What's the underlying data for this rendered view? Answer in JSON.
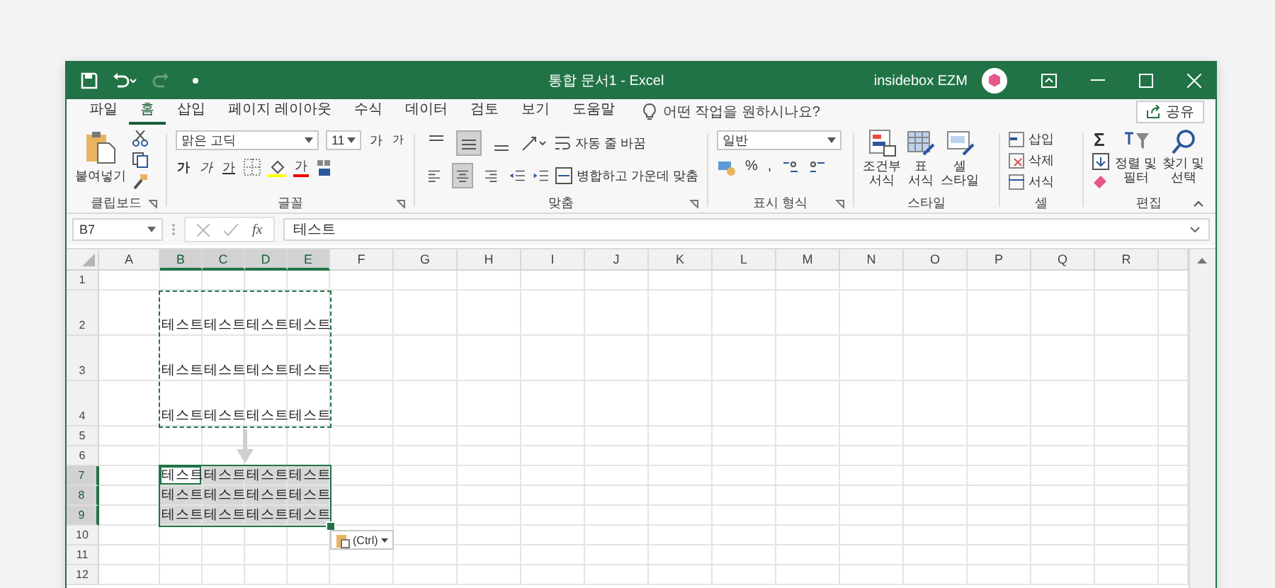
{
  "window": {
    "title": "통합 문서1 - Excel",
    "account": "insidebox EZM"
  },
  "menu_tabs": [
    {
      "label": "파일",
      "selected": false
    },
    {
      "label": "홈",
      "selected": true
    },
    {
      "label": "삽입",
      "selected": false
    },
    {
      "label": "페이지 레이아웃",
      "selected": false
    },
    {
      "label": "수식",
      "selected": false
    },
    {
      "label": "데이터",
      "selected": false
    },
    {
      "label": "검토",
      "selected": false
    },
    {
      "label": "보기",
      "selected": false
    },
    {
      "label": "도움말",
      "selected": false
    }
  ],
  "tell_me": {
    "placeholder": "어떤 작업을 원하시나요?"
  },
  "share_button": "공유",
  "ribbon": {
    "clipboard": {
      "label": "클립보드",
      "paste": "붙여넣기"
    },
    "font": {
      "label": "글꼴",
      "font_name": "맑은 고딕",
      "font_size": "11",
      "grow": "가",
      "shrink": "가",
      "bold": "가",
      "italic": "가",
      "underline": "가",
      "font_color": "가"
    },
    "alignment": {
      "label": "맞춤",
      "wrap_text": "자동 줄 바꿈",
      "merge_center": "병합하고 가운데 맞춤",
      "vertical_buttons": [
        {
          "selected": false
        },
        {
          "selected": true
        },
        {
          "selected": false
        }
      ],
      "horizontal_buttons": [
        {
          "selected": false
        },
        {
          "selected": true
        },
        {
          "selected": false
        }
      ]
    },
    "number": {
      "label": "표시 형식",
      "format": "일반",
      "percent": "%",
      "comma": ","
    },
    "styles": {
      "label": "스타일",
      "conditional": [
        "조건부",
        "서식"
      ],
      "table": [
        "표",
        "서식"
      ],
      "cell": [
        "셀",
        "스타일"
      ]
    },
    "cells": {
      "label": "셀",
      "insert": "삽입",
      "delete": "삭제",
      "format": "서식"
    },
    "editing": {
      "label": "편집",
      "sum": "Σ",
      "sort": [
        "정렬 및",
        "필터"
      ],
      "find": [
        "찾기 및",
        "선택"
      ]
    }
  },
  "formula_bar": {
    "name_box": "B7",
    "fx": "fx",
    "value": "테스트"
  },
  "sheet": {
    "columns": [
      {
        "label": "A",
        "selected": false
      },
      {
        "label": "B",
        "selected": true
      },
      {
        "label": "C",
        "selected": true
      },
      {
        "label": "D",
        "selected": true
      },
      {
        "label": "E",
        "selected": true
      },
      {
        "label": "F",
        "selected": false
      },
      {
        "label": "G",
        "selected": false
      },
      {
        "label": "H",
        "selected": false
      },
      {
        "label": "I",
        "selected": false
      },
      {
        "label": "J",
        "selected": false
      },
      {
        "label": "K",
        "selected": false
      },
      {
        "label": "L",
        "selected": false
      },
      {
        "label": "M",
        "selected": false
      },
      {
        "label": "N",
        "selected": false
      },
      {
        "label": "O",
        "selected": false
      },
      {
        "label": "P",
        "selected": false
      },
      {
        "label": "Q",
        "selected": false
      },
      {
        "label": "R",
        "selected": false
      }
    ],
    "rows": [
      {
        "header": "1",
        "tall": false,
        "selected": false
      },
      {
        "header": "2",
        "tall": true,
        "selected": false,
        "cells": [
          {
            "text": "테스트",
            "copied": true,
            "selected": false,
            "active": false
          },
          {
            "text": "테스트",
            "copied": true,
            "selected": false,
            "active": false
          },
          {
            "text": "테스트",
            "copied": true,
            "selected": false,
            "active": false
          },
          {
            "text": "테스트",
            "copied": true,
            "selected": false,
            "active": false
          }
        ]
      },
      {
        "header": "3",
        "tall": true,
        "selected": false,
        "cells": [
          {
            "text": "테스트",
            "copied": true,
            "selected": false,
            "active": false
          },
          {
            "text": "테스트",
            "copied": true,
            "selected": false,
            "active": false
          },
          {
            "text": "테스트",
            "copied": true,
            "selected": false,
            "active": false
          },
          {
            "text": "테스트",
            "copied": true,
            "selected": false,
            "active": false
          }
        ]
      },
      {
        "header": "4",
        "tall": true,
        "selected": false,
        "cells": [
          {
            "text": "테스트",
            "copied": true,
            "selected": false,
            "active": false
          },
          {
            "text": "테스트",
            "copied": true,
            "selected": false,
            "active": false
          },
          {
            "text": "테스트",
            "copied": true,
            "selected": false,
            "active": false
          },
          {
            "text": "테스트",
            "copied": true,
            "selected": false,
            "active": false
          }
        ]
      },
      {
        "header": "5",
        "tall": false,
        "selected": false
      },
      {
        "header": "6",
        "tall": false,
        "selected": false
      },
      {
        "header": "7",
        "tall": false,
        "selected": true,
        "cells": [
          {
            "text": "테스트",
            "copied": false,
            "selected": true,
            "active": true
          },
          {
            "text": "테스트",
            "copied": false,
            "selected": true,
            "active": false
          },
          {
            "text": "테스트",
            "copied": false,
            "selected": true,
            "active": false
          },
          {
            "text": "테스트",
            "copied": false,
            "selected": true,
            "active": false
          }
        ]
      },
      {
        "header": "8",
        "tall": false,
        "selected": true,
        "cells": [
          {
            "text": "테스트",
            "copied": false,
            "selected": true,
            "active": false
          },
          {
            "text": "테스트",
            "copied": false,
            "selected": true,
            "active": false
          },
          {
            "text": "테스트",
            "copied": false,
            "selected": true,
            "active": false
          },
          {
            "text": "테스트",
            "copied": false,
            "selected": true,
            "active": false
          }
        ]
      },
      {
        "header": "9",
        "tall": false,
        "selected": true,
        "cells": [
          {
            "text": "테스트",
            "copied": false,
            "selected": true,
            "active": false
          },
          {
            "text": "테스트",
            "copied": false,
            "selected": true,
            "active": false
          },
          {
            "text": "테스트",
            "copied": false,
            "selected": true,
            "active": false
          },
          {
            "text": "테스트",
            "copied": false,
            "selected": true,
            "active": false
          }
        ]
      },
      {
        "header": "10",
        "tall": false,
        "selected": false
      },
      {
        "header": "11",
        "tall": false,
        "selected": false
      },
      {
        "header": "12",
        "tall": false,
        "selected": false
      }
    ],
    "paste_options": {
      "label": "(Ctrl)"
    }
  }
}
